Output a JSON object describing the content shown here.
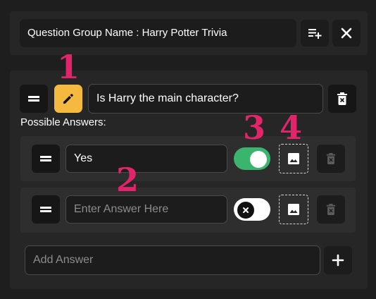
{
  "header": {
    "group_name": "Question Group Name : Harry Potter Trivia",
    "add_list_icon": "playlist-add-icon",
    "close_icon": "close-icon"
  },
  "question": {
    "text": "Is Harry the main character?",
    "edit_icon": "pencil-icon",
    "delete_icon": "trash-icon",
    "possible_answers_label": "Possible Answers:"
  },
  "answers": [
    {
      "value": "Yes",
      "placeholder": "Enter Answer Here",
      "correct": true
    },
    {
      "value": "",
      "placeholder": "Enter Answer Here",
      "correct": false
    }
  ],
  "add_answer": {
    "placeholder": "Add Answer",
    "button_icon": "plus-icon"
  },
  "markers": [
    "1",
    "2",
    "3",
    "4"
  ],
  "colors": {
    "accent_yellow": "#f5b93f",
    "toggle_green": "#3bb56e",
    "marker_pink": "#e2246b",
    "background": "#1e1e1e",
    "panel": "#262626"
  }
}
